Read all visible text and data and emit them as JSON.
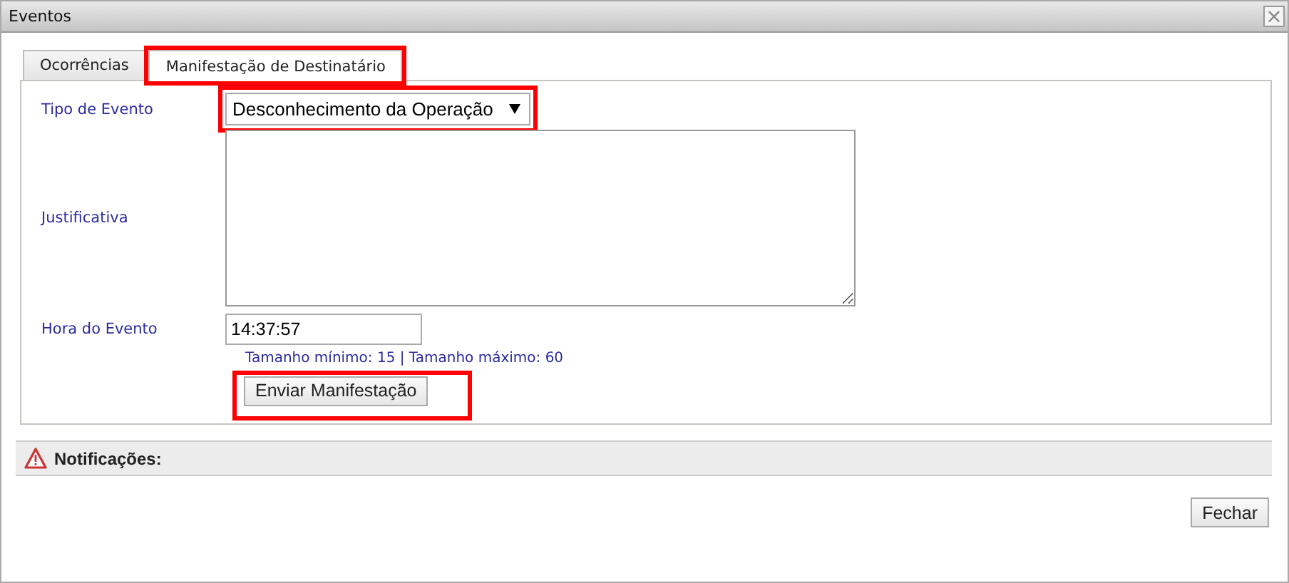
{
  "window": {
    "title": "Eventos",
    "close": "×"
  },
  "tabs": [
    {
      "label": "Ocorrências",
      "selected": false,
      "highlighted": false
    },
    {
      "label": "Manifestação de Destinatário",
      "selected": true,
      "highlighted": true
    }
  ],
  "form": {
    "tipo": {
      "label": "Tipo de Evento",
      "value": "Desconhecimento da Operação",
      "highlighted": true
    },
    "justificativa": {
      "label": "Justificativa"
    },
    "hora": {
      "label": "Hora do Evento",
      "value": "14:37:57"
    },
    "hint": "Tamanho mínimo: 15 | Tamanho máximo: 60",
    "submit": {
      "label": "Enviar Manifestação",
      "highlighted": true
    }
  },
  "notifications": {
    "title": "Notificações:"
  },
  "buttons": [
    "Fechar"
  ]
}
